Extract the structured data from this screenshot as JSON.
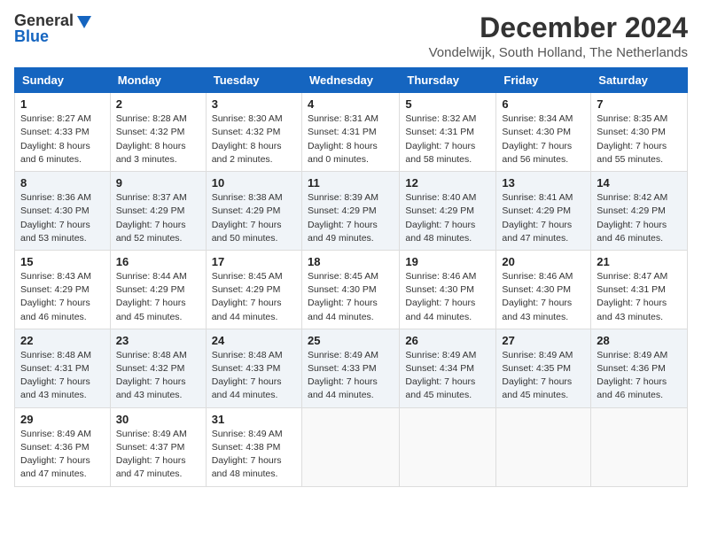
{
  "header": {
    "logo_line1": "General",
    "logo_line2": "Blue",
    "main_title": "December 2024",
    "subtitle": "Vondelwijk, South Holland, The Netherlands"
  },
  "columns": [
    "Sunday",
    "Monday",
    "Tuesday",
    "Wednesday",
    "Thursday",
    "Friday",
    "Saturday"
  ],
  "weeks": [
    [
      {
        "day": "1",
        "info": "Sunrise: 8:27 AM\nSunset: 4:33 PM\nDaylight: 8 hours\nand 6 minutes."
      },
      {
        "day": "2",
        "info": "Sunrise: 8:28 AM\nSunset: 4:32 PM\nDaylight: 8 hours\nand 3 minutes."
      },
      {
        "day": "3",
        "info": "Sunrise: 8:30 AM\nSunset: 4:32 PM\nDaylight: 8 hours\nand 2 minutes."
      },
      {
        "day": "4",
        "info": "Sunrise: 8:31 AM\nSunset: 4:31 PM\nDaylight: 8 hours\nand 0 minutes."
      },
      {
        "day": "5",
        "info": "Sunrise: 8:32 AM\nSunset: 4:31 PM\nDaylight: 7 hours\nand 58 minutes."
      },
      {
        "day": "6",
        "info": "Sunrise: 8:34 AM\nSunset: 4:30 PM\nDaylight: 7 hours\nand 56 minutes."
      },
      {
        "day": "7",
        "info": "Sunrise: 8:35 AM\nSunset: 4:30 PM\nDaylight: 7 hours\nand 55 minutes."
      }
    ],
    [
      {
        "day": "8",
        "info": "Sunrise: 8:36 AM\nSunset: 4:30 PM\nDaylight: 7 hours\nand 53 minutes."
      },
      {
        "day": "9",
        "info": "Sunrise: 8:37 AM\nSunset: 4:29 PM\nDaylight: 7 hours\nand 52 minutes."
      },
      {
        "day": "10",
        "info": "Sunrise: 8:38 AM\nSunset: 4:29 PM\nDaylight: 7 hours\nand 50 minutes."
      },
      {
        "day": "11",
        "info": "Sunrise: 8:39 AM\nSunset: 4:29 PM\nDaylight: 7 hours\nand 49 minutes."
      },
      {
        "day": "12",
        "info": "Sunrise: 8:40 AM\nSunset: 4:29 PM\nDaylight: 7 hours\nand 48 minutes."
      },
      {
        "day": "13",
        "info": "Sunrise: 8:41 AM\nSunset: 4:29 PM\nDaylight: 7 hours\nand 47 minutes."
      },
      {
        "day": "14",
        "info": "Sunrise: 8:42 AM\nSunset: 4:29 PM\nDaylight: 7 hours\nand 46 minutes."
      }
    ],
    [
      {
        "day": "15",
        "info": "Sunrise: 8:43 AM\nSunset: 4:29 PM\nDaylight: 7 hours\nand 46 minutes."
      },
      {
        "day": "16",
        "info": "Sunrise: 8:44 AM\nSunset: 4:29 PM\nDaylight: 7 hours\nand 45 minutes."
      },
      {
        "day": "17",
        "info": "Sunrise: 8:45 AM\nSunset: 4:29 PM\nDaylight: 7 hours\nand 44 minutes."
      },
      {
        "day": "18",
        "info": "Sunrise: 8:45 AM\nSunset: 4:30 PM\nDaylight: 7 hours\nand 44 minutes."
      },
      {
        "day": "19",
        "info": "Sunrise: 8:46 AM\nSunset: 4:30 PM\nDaylight: 7 hours\nand 44 minutes."
      },
      {
        "day": "20",
        "info": "Sunrise: 8:46 AM\nSunset: 4:30 PM\nDaylight: 7 hours\nand 43 minutes."
      },
      {
        "day": "21",
        "info": "Sunrise: 8:47 AM\nSunset: 4:31 PM\nDaylight: 7 hours\nand 43 minutes."
      }
    ],
    [
      {
        "day": "22",
        "info": "Sunrise: 8:48 AM\nSunset: 4:31 PM\nDaylight: 7 hours\nand 43 minutes."
      },
      {
        "day": "23",
        "info": "Sunrise: 8:48 AM\nSunset: 4:32 PM\nDaylight: 7 hours\nand 43 minutes."
      },
      {
        "day": "24",
        "info": "Sunrise: 8:48 AM\nSunset: 4:33 PM\nDaylight: 7 hours\nand 44 minutes."
      },
      {
        "day": "25",
        "info": "Sunrise: 8:49 AM\nSunset: 4:33 PM\nDaylight: 7 hours\nand 44 minutes."
      },
      {
        "day": "26",
        "info": "Sunrise: 8:49 AM\nSunset: 4:34 PM\nDaylight: 7 hours\nand 45 minutes."
      },
      {
        "day": "27",
        "info": "Sunrise: 8:49 AM\nSunset: 4:35 PM\nDaylight: 7 hours\nand 45 minutes."
      },
      {
        "day": "28",
        "info": "Sunrise: 8:49 AM\nSunset: 4:36 PM\nDaylight: 7 hours\nand 46 minutes."
      }
    ],
    [
      {
        "day": "29",
        "info": "Sunrise: 8:49 AM\nSunset: 4:36 PM\nDaylight: 7 hours\nand 47 minutes."
      },
      {
        "day": "30",
        "info": "Sunrise: 8:49 AM\nSunset: 4:37 PM\nDaylight: 7 hours\nand 47 minutes."
      },
      {
        "day": "31",
        "info": "Sunrise: 8:49 AM\nSunset: 4:38 PM\nDaylight: 7 hours\nand 48 minutes."
      },
      {
        "day": "",
        "info": ""
      },
      {
        "day": "",
        "info": ""
      },
      {
        "day": "",
        "info": ""
      },
      {
        "day": "",
        "info": ""
      }
    ]
  ]
}
